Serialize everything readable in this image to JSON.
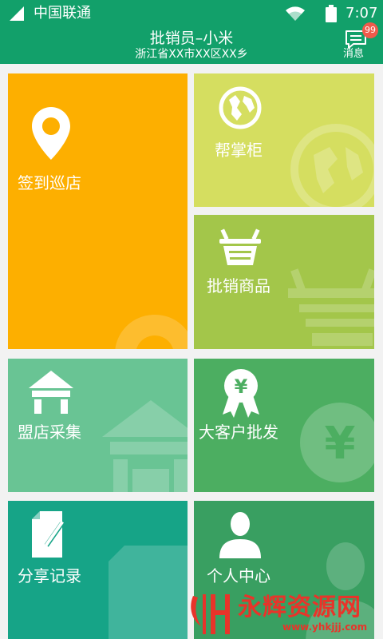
{
  "status_bar": {
    "carrier": "中国联通",
    "time": "7:07",
    "icons": [
      "signal-icon",
      "wifi-icon",
      "battery-icon"
    ]
  },
  "header": {
    "title": "批销员–小米",
    "subtitle": "浙江省XX市XX区XX乡",
    "messages_label": "消息",
    "badge_count": "99"
  },
  "tiles": [
    {
      "label": "签到巡店",
      "icon": "location-pin-icon",
      "color": "#fdaf00"
    },
    {
      "label": "帮掌柜",
      "icon": "globe-icon",
      "color": "#d5de60"
    },
    {
      "label": "批销商品",
      "icon": "shopping-basket-icon",
      "color": "#a3c64a"
    },
    {
      "label": "盟店采集",
      "icon": "store-icon",
      "color": "#69c494"
    },
    {
      "label": "大客户批发",
      "icon": "yen-badge-icon",
      "color": "#4cae61"
    },
    {
      "label": "分享记录",
      "icon": "document-pen-icon",
      "color": "#16a487"
    },
    {
      "label": "个人中心",
      "icon": "user-icon",
      "color": "#399f61"
    }
  ],
  "watermark": {
    "name": "永辉资源网",
    "url": "www.yhkjjj.com"
  },
  "colors": {
    "header": "#12a06a",
    "badge": "#f05a4b",
    "background": "#f2f2f2"
  }
}
